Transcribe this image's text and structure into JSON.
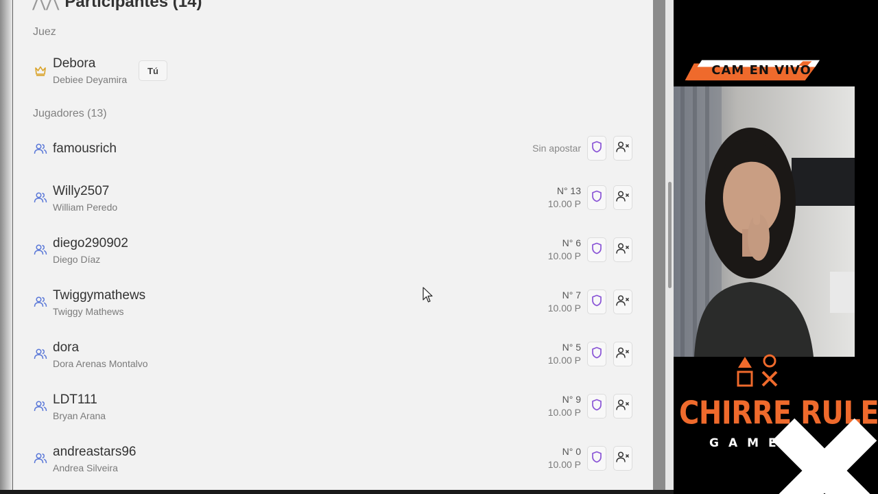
{
  "panel": {
    "title": "Participantes (14)"
  },
  "judge_section": {
    "label": "Juez",
    "judge": {
      "username": "Debora",
      "fullname": "Debiee Deyamira",
      "badge": "Tú",
      "icon": "crown-icon"
    }
  },
  "players_section": {
    "label": "Jugadores (13)",
    "players": [
      {
        "username": "famousrich",
        "fullname": "",
        "status": "Sin apostar",
        "number": "",
        "amount": ""
      },
      {
        "username": "Willy2507",
        "fullname": "William Peredo",
        "status": "",
        "number": "N° 13",
        "amount": "10.00 P"
      },
      {
        "username": "diego290902",
        "fullname": "Diego Díaz",
        "status": "",
        "number": "N° 6",
        "amount": "10.00 P"
      },
      {
        "username": "Twiggymathews",
        "fullname": "Twiggy Mathews",
        "status": "",
        "number": "N° 7",
        "amount": "10.00 P"
      },
      {
        "username": "dora",
        "fullname": "Dora Arenas Montalvo",
        "status": "",
        "number": "N° 5",
        "amount": "10.00 P"
      },
      {
        "username": "LDT111",
        "fullname": "Bryan Arana",
        "status": "",
        "number": "N° 9",
        "amount": "10.00 P"
      },
      {
        "username": "andreastars96",
        "fullname": "Andrea Silveira",
        "status": "",
        "number": "N° 0",
        "amount": "10.00 P"
      }
    ]
  },
  "overlay": {
    "cam_label": "CAM EN VIVO",
    "brand": "CHIRRE RULETA",
    "brand_sub": "GAMES"
  },
  "colors": {
    "accent_orange": "#ef6a2c",
    "user_icon_blue": "#5a78d8",
    "shield_purple": "#8a55d6",
    "crown_gold": "#d9a227"
  }
}
